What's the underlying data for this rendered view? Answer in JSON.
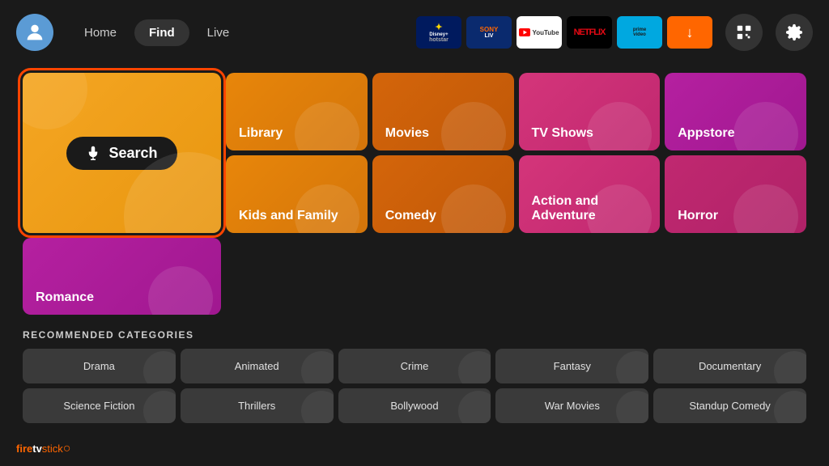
{
  "header": {
    "nav": {
      "home_label": "Home",
      "find_label": "Find",
      "live_label": "Live",
      "active": "find"
    },
    "apps": [
      {
        "id": "disney",
        "label": "Disney+ Hotstar",
        "display": "disney+\nhotstar"
      },
      {
        "id": "sony",
        "label": "Sony Liv",
        "display": "SONY\nLIV"
      },
      {
        "id": "youtube",
        "label": "YouTube",
        "display": "▶ YouTube"
      },
      {
        "id": "netflix",
        "label": "Netflix",
        "display": "NETFLIX"
      },
      {
        "id": "prime",
        "label": "Prime Video",
        "display": "prime\nvideo"
      },
      {
        "id": "downloader",
        "label": "Downloader",
        "display": "↓\nDownloader"
      }
    ]
  },
  "main_grid": {
    "tiles": [
      {
        "id": "search",
        "label": "Search",
        "type": "search"
      },
      {
        "id": "library",
        "label": "Library",
        "type": "normal"
      },
      {
        "id": "movies",
        "label": "Movies",
        "type": "normal"
      },
      {
        "id": "tvshows",
        "label": "TV Shows",
        "type": "normal"
      },
      {
        "id": "appstore",
        "label": "Appstore",
        "type": "normal"
      },
      {
        "id": "kids",
        "label": "Kids and Family",
        "type": "normal"
      },
      {
        "id": "comedy",
        "label": "Comedy",
        "type": "normal"
      },
      {
        "id": "action",
        "label": "Action and Adventure",
        "type": "normal"
      },
      {
        "id": "horror",
        "label": "Horror",
        "type": "normal"
      },
      {
        "id": "romance",
        "label": "Romance",
        "type": "normal"
      }
    ]
  },
  "recommended": {
    "title": "RECOMMENDED CATEGORIES",
    "tiles": [
      {
        "id": "drama",
        "label": "Drama"
      },
      {
        "id": "animated",
        "label": "Animated"
      },
      {
        "id": "crime",
        "label": "Crime"
      },
      {
        "id": "fantasy",
        "label": "Fantasy"
      },
      {
        "id": "documentary",
        "label": "Documentary"
      },
      {
        "id": "scifi",
        "label": "Science Fiction"
      },
      {
        "id": "thrillers",
        "label": "Thrillers"
      },
      {
        "id": "bollywood",
        "label": "Bollywood"
      },
      {
        "id": "warmovies",
        "label": "War Movies"
      },
      {
        "id": "standup",
        "label": "Standup Comedy"
      }
    ]
  },
  "footer": {
    "brand": "fire",
    "brand2": "tv",
    "brand3": "stick"
  }
}
